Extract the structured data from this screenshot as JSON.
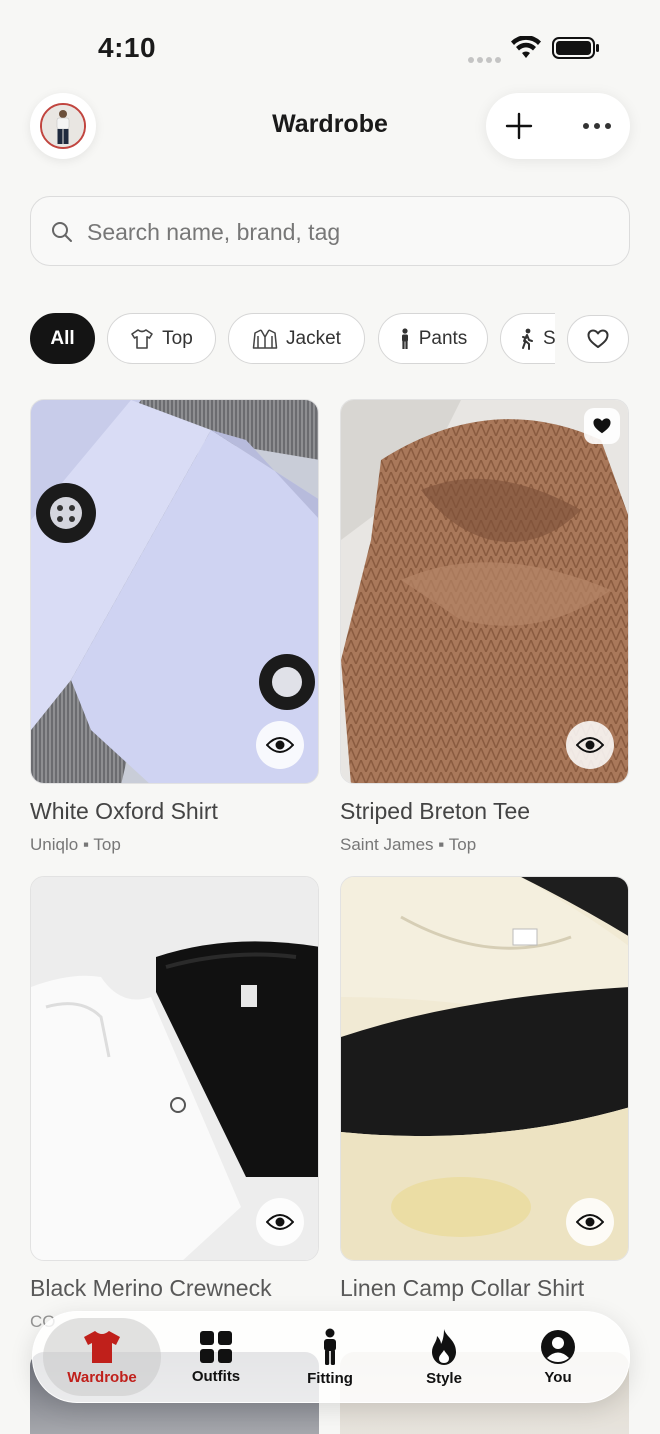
{
  "status_bar": {
    "time": "4:10"
  },
  "header": {
    "title": "Wardrobe"
  },
  "search": {
    "placeholder": "Search name, brand, tag"
  },
  "filters": [
    {
      "label": "All",
      "icon": "none",
      "active": true
    },
    {
      "label": "Top",
      "icon": "tshirt-icon"
    },
    {
      "label": "Jacket",
      "icon": "jacket-icon"
    },
    {
      "label": "Pants",
      "icon": "person-icon"
    },
    {
      "label": "S",
      "icon": "walking-icon"
    }
  ],
  "items": [
    {
      "name": "White Oxford Shirt",
      "brand": "Uniqlo",
      "category": "Top",
      "favorite": false
    },
    {
      "name": "Striped Breton Tee",
      "brand": "Saint James",
      "category": "Top",
      "favorite": true
    },
    {
      "name": "Black Merino Crewneck",
      "brand": "CO",
      "category": "",
      "favorite": false
    },
    {
      "name": "Linen Camp Collar Shirt",
      "brand": "",
      "category": "",
      "favorite": false
    }
  ],
  "tabs": [
    {
      "label": "Wardrobe",
      "icon": "tshirt-icon",
      "active": true
    },
    {
      "label": "Outfits",
      "icon": "grid-icon"
    },
    {
      "label": "Fitting",
      "icon": "person-icon"
    },
    {
      "label": "Style",
      "icon": "flame-icon"
    },
    {
      "label": "You",
      "icon": "user-circle-icon"
    }
  ],
  "colors": {
    "accent": "#c0201b",
    "chip_active": "#141414"
  }
}
